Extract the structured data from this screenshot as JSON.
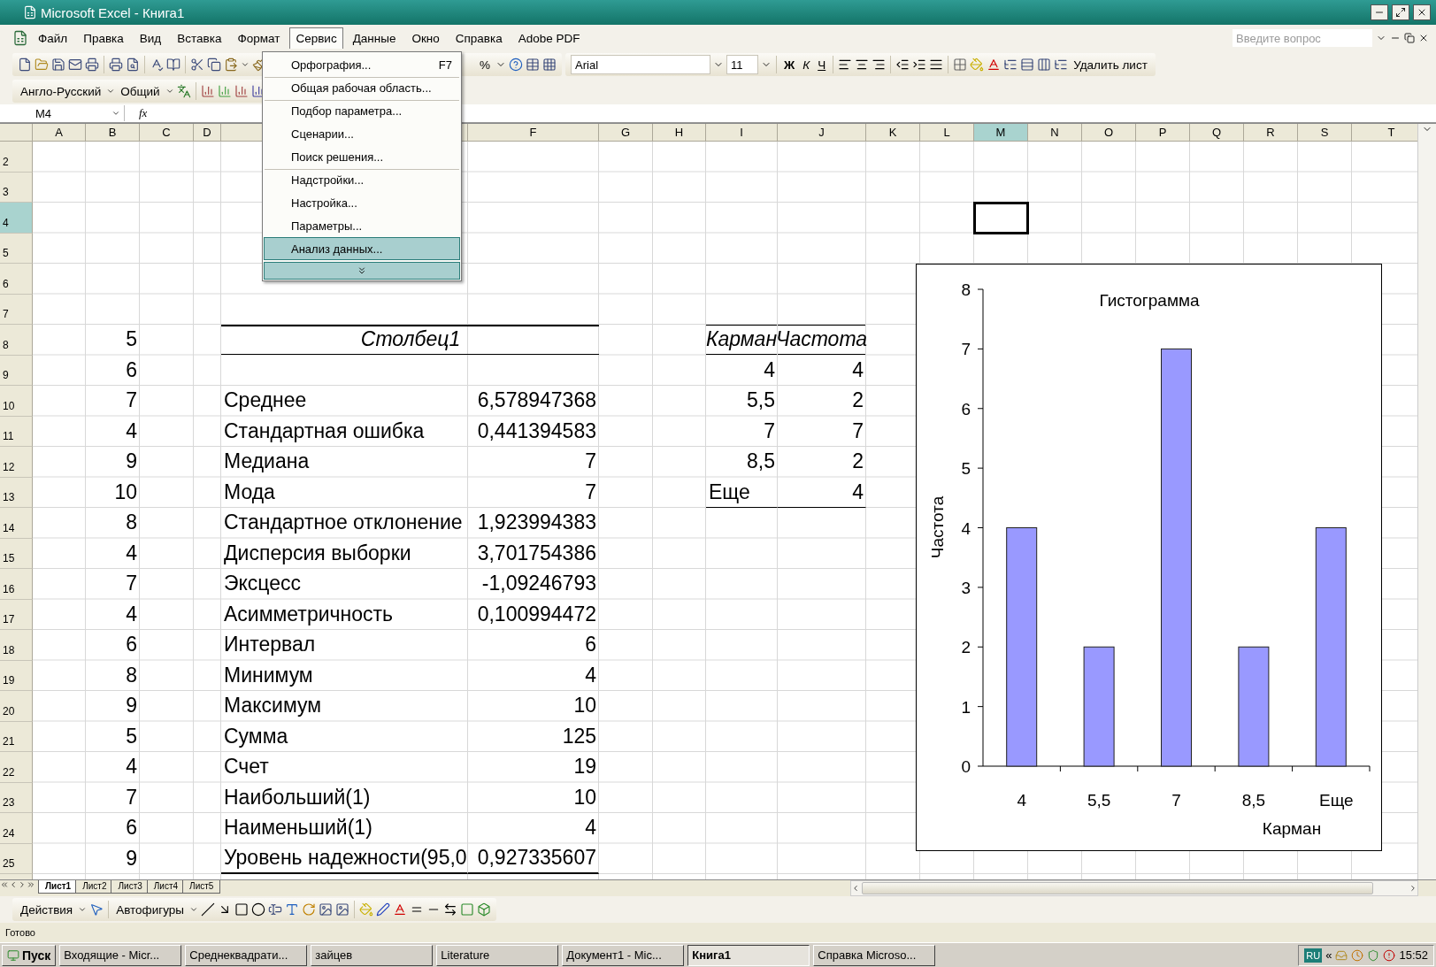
{
  "window": {
    "title": "Microsoft Excel - Книга1"
  },
  "menu_bar": {
    "items": [
      {
        "label": "Файл",
        "selected": false
      },
      {
        "label": "Правка",
        "selected": false
      },
      {
        "label": "Вид",
        "selected": false
      },
      {
        "label": "Вставка",
        "selected": false
      },
      {
        "label": "Формат",
        "selected": false
      },
      {
        "label": "Сервис",
        "selected": true
      },
      {
        "label": "Данные",
        "selected": false
      },
      {
        "label": "Окно",
        "selected": false
      },
      {
        "label": "Справка",
        "selected": false
      },
      {
        "label": "Adobe PDF",
        "selected": false
      }
    ],
    "help_search": {
      "placeholder": "Введите вопрос"
    }
  },
  "standard_toolbar": {
    "zoom": "%"
  },
  "formatting_toolbar": {
    "font": "Arial",
    "size": "11",
    "buttons": [
      "Ж",
      "К",
      "Ч"
    ],
    "delete_sheet": "Удалить лист"
  },
  "translation_toolbar": {
    "dictionary": "Англо-Русский",
    "mode": "Общий"
  },
  "formula_bar": {
    "name_box": "M4",
    "function_label": "fx"
  },
  "open_menu": {
    "items": [
      {
        "label": "Орфография...",
        "shortcut": "F7",
        "separator_before": false,
        "selected": false
      },
      {
        "label": "Общая рабочая область...",
        "separator_before": true,
        "selected": false
      },
      {
        "label": "Подбор параметра...",
        "separator_before": true,
        "selected": false
      },
      {
        "label": "Сценарии...",
        "separator_before": false,
        "selected": false
      },
      {
        "label": "Поиск решения...",
        "separator_before": false,
        "selected": false
      },
      {
        "label": "Надстройки...",
        "separator_before": true,
        "selected": false
      },
      {
        "label": "Настройка...",
        "separator_before": false,
        "selected": false
      },
      {
        "label": "Параметры...",
        "separator_before": false,
        "selected": false
      },
      {
        "label": "Анализ данных...",
        "separator_before": false,
        "selected": true
      }
    ]
  },
  "sheet": {
    "columns": [
      {
        "label": "A",
        "selected": false
      },
      {
        "label": "B",
        "selected": false
      },
      {
        "label": "C",
        "selected": false
      },
      {
        "label": "D",
        "selected": false
      },
      {
        "selected": false
      },
      {
        "label": "F",
        "selected": false
      },
      {
        "label": "G",
        "selected": false
      },
      {
        "label": "H",
        "selected": false
      },
      {
        "label": "I",
        "selected": false
      },
      {
        "label": "J",
        "selected": false
      },
      {
        "label": "K",
        "selected": false
      },
      {
        "label": "L",
        "selected": false
      },
      {
        "label": "M",
        "selected": true
      },
      {
        "label": "N",
        "selected": false
      },
      {
        "label": "O",
        "selected": false
      },
      {
        "label": "P",
        "selected": false
      },
      {
        "label": "Q",
        "selected": false
      },
      {
        "label": "R",
        "selected": false
      },
      {
        "label": "S",
        "selected": false
      },
      {
        "label": "T",
        "selected": false
      }
    ],
    "rows": [
      {
        "number": "2",
        "selected": false
      },
      {
        "number": "3",
        "selected": false
      },
      {
        "number": "4",
        "selected": true
      },
      {
        "number": "5",
        "selected": false
      },
      {
        "number": "6",
        "selected": false
      },
      {
        "number": "7",
        "selected": false
      },
      {
        "number": "8",
        "selected": false,
        "cells": {
          "b": {
            "kind": "number",
            "text": "5"
          },
          "e": {
            "kind": "title",
            "text": "Столбец1"
          },
          "i": {
            "kind": "head",
            "text": "Карман"
          },
          "j": {
            "kind": "head",
            "text": "Частота"
          }
        }
      },
      {
        "number": "9",
        "selected": false,
        "cells": {
          "b": {
            "kind": "number",
            "text": "6"
          },
          "i": {
            "kind": "number",
            "text": "4"
          },
          "j": {
            "kind": "number",
            "text": "4"
          }
        }
      },
      {
        "number": "10",
        "selected": false,
        "cells": {
          "b": {
            "kind": "number",
            "text": "7"
          },
          "e": {
            "kind": "text",
            "text": "Среднее"
          },
          "f": {
            "kind": "number",
            "text": "6,578947368"
          },
          "i": {
            "kind": "number",
            "text": "5,5"
          },
          "j": {
            "kind": "number",
            "text": "2"
          }
        }
      },
      {
        "number": "11",
        "selected": false,
        "cells": {
          "b": {
            "kind": "number",
            "text": "4"
          },
          "e": {
            "kind": "text",
            "text": "Стандартная ошибка"
          },
          "f": {
            "kind": "number",
            "text": "0,441394583"
          },
          "i": {
            "kind": "number",
            "text": "7"
          },
          "j": {
            "kind": "number",
            "text": "7"
          }
        }
      },
      {
        "number": "12",
        "selected": false,
        "cells": {
          "b": {
            "kind": "number",
            "text": "9"
          },
          "e": {
            "kind": "text",
            "text": "Медиана"
          },
          "f": {
            "kind": "number",
            "text": "7"
          },
          "i": {
            "kind": "number",
            "text": "8,5"
          },
          "j": {
            "kind": "number",
            "text": "2"
          }
        }
      },
      {
        "number": "13",
        "selected": false,
        "cells": {
          "b": {
            "kind": "number",
            "text": "10"
          },
          "e": {
            "kind": "text",
            "text": "Мода"
          },
          "f": {
            "kind": "number",
            "text": "7"
          },
          "i": {
            "kind": "text",
            "text": "Еще",
            "border_below": true
          },
          "j": {
            "kind": "number",
            "text": "4",
            "border_below": true
          }
        }
      },
      {
        "number": "14",
        "selected": false,
        "cells": {
          "b": {
            "kind": "number",
            "text": "8"
          },
          "e": {
            "kind": "text",
            "text": "Стандартное отклонение"
          },
          "f": {
            "kind": "number",
            "text": "1,923994383"
          }
        }
      },
      {
        "number": "15",
        "selected": false,
        "cells": {
          "b": {
            "kind": "number",
            "text": "4"
          },
          "e": {
            "kind": "text",
            "text": "Дисперсия выборки"
          },
          "f": {
            "kind": "number",
            "text": "3,701754386"
          }
        }
      },
      {
        "number": "16",
        "selected": false,
        "cells": {
          "b": {
            "kind": "number",
            "text": "7"
          },
          "e": {
            "kind": "text",
            "text": "Эксцесс"
          },
          "f": {
            "kind": "number",
            "text": "-1,09246793"
          }
        }
      },
      {
        "number": "17",
        "selected": false,
        "cells": {
          "b": {
            "kind": "number",
            "text": "4"
          },
          "e": {
            "kind": "text",
            "text": "Асимметричность"
          },
          "f": {
            "kind": "number",
            "text": "0,100994472"
          }
        }
      },
      {
        "number": "18",
        "selected": false,
        "cells": {
          "b": {
            "kind": "number",
            "text": "6"
          },
          "e": {
            "kind": "text",
            "text": "Интервал"
          },
          "f": {
            "kind": "number",
            "text": "6"
          }
        }
      },
      {
        "number": "19",
        "selected": false,
        "cells": {
          "b": {
            "kind": "number",
            "text": "8"
          },
          "e": {
            "kind": "text",
            "text": "Минимум"
          },
          "f": {
            "kind": "number",
            "text": "4"
          }
        }
      },
      {
        "number": "20",
        "selected": false,
        "cells": {
          "b": {
            "kind": "number",
            "text": "9"
          },
          "e": {
            "kind": "text",
            "text": "Максимум"
          },
          "f": {
            "kind": "number",
            "text": "10"
          }
        }
      },
      {
        "number": "21",
        "selected": false,
        "cells": {
          "b": {
            "kind": "number",
            "text": "5"
          },
          "e": {
            "kind": "text",
            "text": "Сумма"
          },
          "f": {
            "kind": "number",
            "text": "125"
          }
        }
      },
      {
        "number": "22",
        "selected": false,
        "cells": {
          "b": {
            "kind": "number",
            "text": "4"
          },
          "e": {
            "kind": "text",
            "text": "Счет"
          },
          "f": {
            "kind": "number",
            "text": "19"
          }
        }
      },
      {
        "number": "23",
        "selected": false,
        "cells": {
          "b": {
            "kind": "number",
            "text": "7"
          },
          "e": {
            "kind": "text",
            "text": "Наибольший(1)"
          },
          "f": {
            "kind": "number",
            "text": "10"
          }
        }
      },
      {
        "number": "24",
        "selected": false,
        "cells": {
          "b": {
            "kind": "number",
            "text": "6"
          },
          "e": {
            "kind": "text",
            "text": "Наименьший(1)"
          },
          "f": {
            "kind": "number",
            "text": "4"
          }
        }
      },
      {
        "number": "25",
        "selected": false,
        "cells": {
          "b": {
            "kind": "number",
            "text": "9"
          },
          "e": {
            "kind": "text",
            "text": "Уровень надежности(95,0",
            "heavy_border_below": true
          },
          "f": {
            "kind": "number",
            "text": "0,927335607",
            "heavy_border_below": true
          }
        }
      }
    ]
  },
  "chart": {
    "chart_data": {
      "type": "bar",
      "title": "Гистограмма",
      "xlabel": "Карман",
      "ylabel": "Частота",
      "categories": [
        "4",
        "5,5",
        "7",
        "8,5",
        "Еще"
      ],
      "series": [
        {
          "color": "#9999ff",
          "values": [
            4,
            2,
            7,
            2,
            4
          ]
        }
      ],
      "ylim": [
        0,
        8
      ],
      "yticks": [
        0,
        1,
        2,
        3,
        4,
        5,
        6,
        7,
        8
      ]
    }
  },
  "sheet_tabs": [
    {
      "label": "Лист1",
      "selected": true
    },
    {
      "label": "Лист2",
      "selected": false
    },
    {
      "label": "Лист3",
      "selected": false
    },
    {
      "label": "Лист4",
      "selected": false
    },
    {
      "label": "Лист5",
      "selected": false
    }
  ],
  "drawing_toolbar": {
    "actions": "Действия",
    "autoshapes": "Автофигуры"
  },
  "status_bar": {
    "text": "Готово"
  },
  "taskbar": {
    "start": "Пуск",
    "tasks": [
      {
        "label": "Входящие - Micr...",
        "selected": false
      },
      {
        "label": "Среднеквадрати...",
        "selected": false
      },
      {
        "label": "зайцев",
        "selected": false
      },
      {
        "label": "Literature",
        "selected": false
      },
      {
        "label": "Документ1 - Mic...",
        "selected": false
      },
      {
        "label": "Книга1",
        "selected": true
      },
      {
        "label": "Справка Microso...",
        "selected": false
      }
    ],
    "language": "RU",
    "tray_toggle": "«",
    "clock": "15:52"
  }
}
